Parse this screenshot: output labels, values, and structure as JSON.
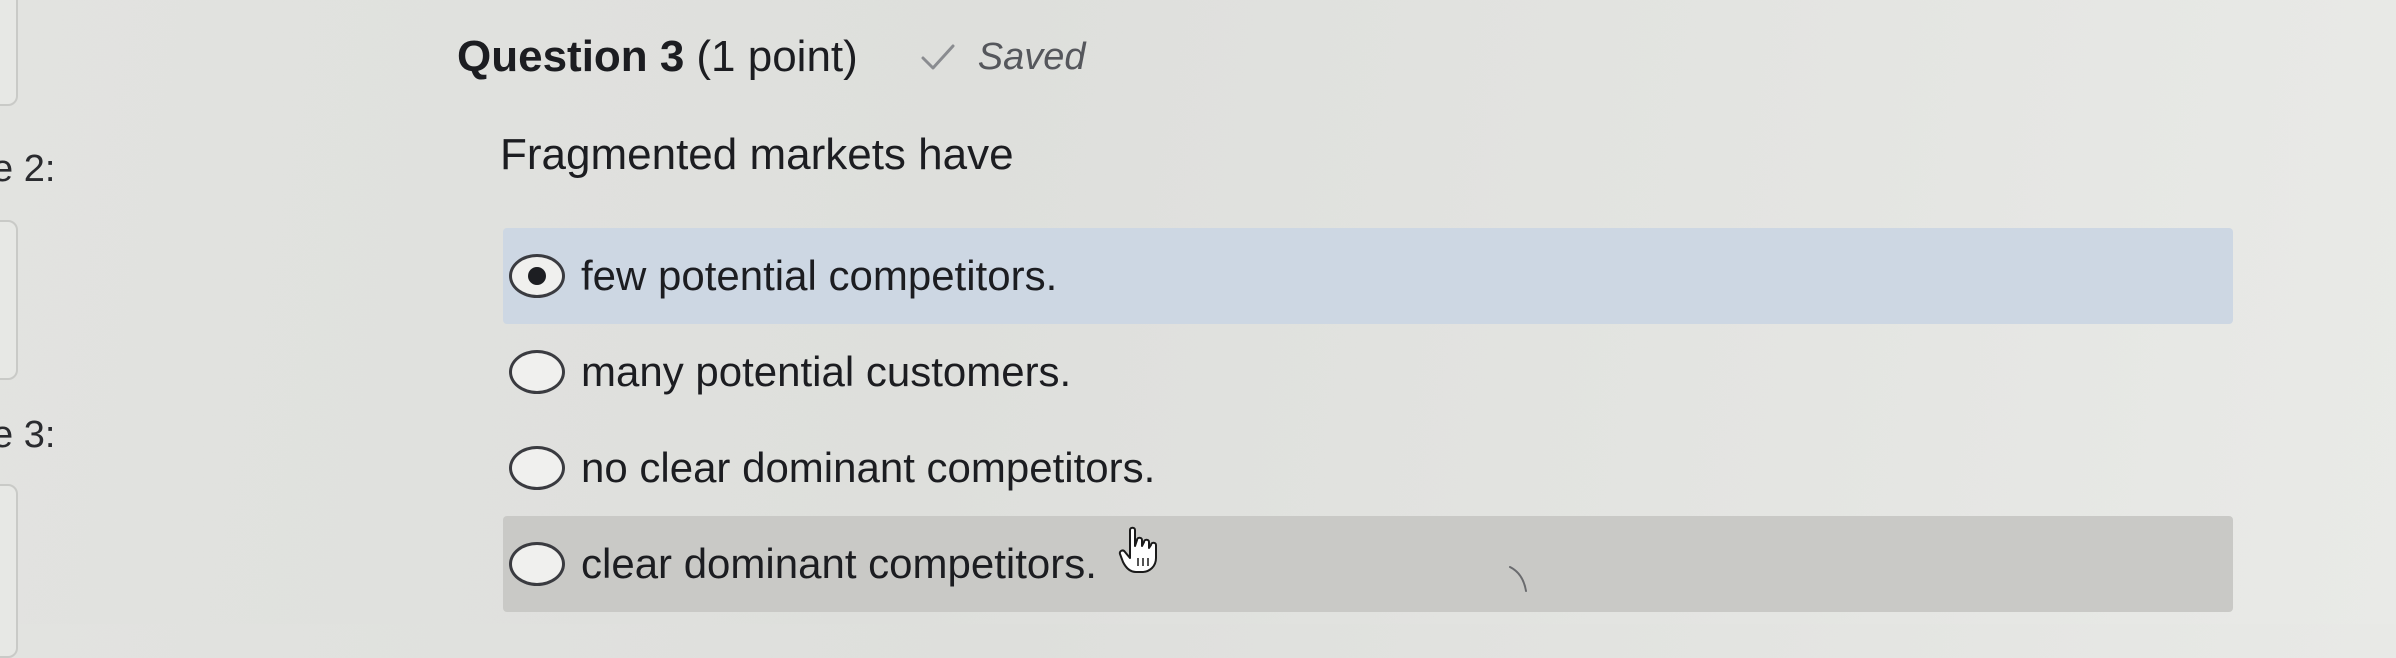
{
  "sidebar": {
    "items": [
      {
        "label": "e 2:"
      },
      {
        "label": "e 3:"
      }
    ]
  },
  "question": {
    "title": "Question 3",
    "points": "(1 point)",
    "status": "Saved",
    "status_icon": "check-icon",
    "prompt": "Fragmented markets have"
  },
  "options": [
    {
      "label": "few potential competitors.",
      "selected": true
    },
    {
      "label": "many potential customers.",
      "selected": false
    },
    {
      "label": "no clear dominant competitors.",
      "selected": false
    },
    {
      "label": "clear dominant competitors.",
      "selected": false
    }
  ],
  "colors": {
    "selected_bg": "#cdd7e3",
    "hover_bg": "#c9c9c6",
    "text": "#1c1d21"
  }
}
